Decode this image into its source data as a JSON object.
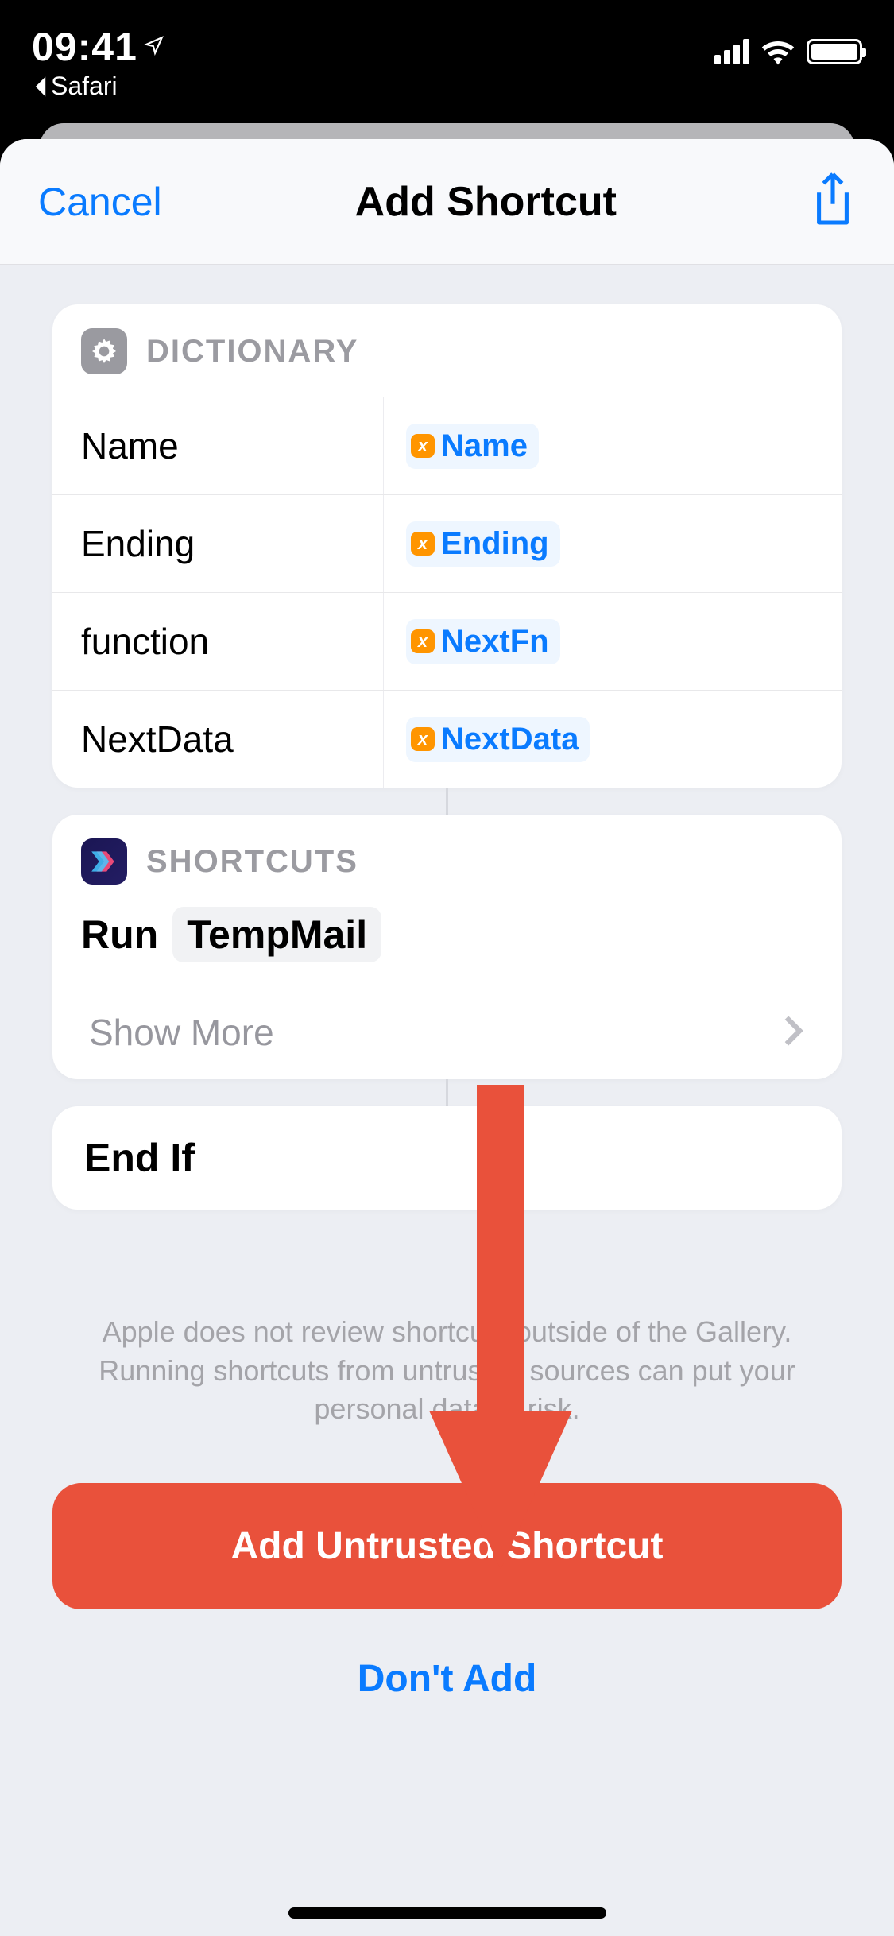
{
  "statusbar": {
    "time": "09:41",
    "back_app": "Safari"
  },
  "header": {
    "cancel": "Cancel",
    "title": "Add Shortcut"
  },
  "dictionary": {
    "label": "DICTIONARY",
    "rows": [
      {
        "key": "Name",
        "var": "Name"
      },
      {
        "key": "Ending",
        "var": "Ending"
      },
      {
        "key": "function",
        "var": "NextFn"
      },
      {
        "key": "NextData",
        "var": "NextData"
      }
    ]
  },
  "shortcuts": {
    "label": "SHORTCUTS",
    "run_word": "Run",
    "run_target": "TempMail",
    "show_more": "Show More"
  },
  "endif": "End If",
  "warning": "Apple does not review shortcuts outside of the Gallery. Running shortcuts from untrusted sources can put your personal data at risk.",
  "buttons": {
    "add": "Add Untrusted Shortcut",
    "dont": "Don't Add"
  },
  "annotation": {
    "arrow_color": "#e9513b"
  }
}
